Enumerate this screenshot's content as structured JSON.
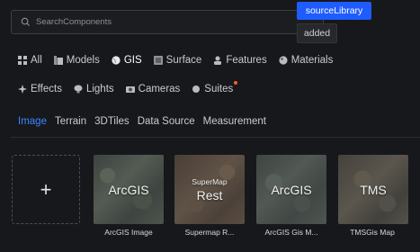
{
  "search": {
    "placeholder": "SearchComponents"
  },
  "tooltips": {
    "primary": "sourceLibrary",
    "secondary": "added"
  },
  "categories_row1": [
    {
      "label": "All",
      "icon": "grid-icon"
    },
    {
      "label": "Models",
      "icon": "cube-icon"
    },
    {
      "label": "GIS",
      "icon": "globe-icon",
      "active": true
    },
    {
      "label": "Surface",
      "icon": "surface-icon"
    },
    {
      "label": "Features",
      "icon": "features-icon"
    },
    {
      "label": "Materials",
      "icon": "material-ball-icon"
    }
  ],
  "categories_row2": [
    {
      "label": "Effects",
      "icon": "sparkle-icon"
    },
    {
      "label": "Lights",
      "icon": "bulb-icon"
    },
    {
      "label": "Cameras",
      "icon": "camera-icon"
    },
    {
      "label": "Suites",
      "icon": "suite-icon",
      "badge": true
    }
  ],
  "subtabs": [
    "Image",
    "Terrain",
    "3DTiles",
    "Data Source",
    "Measurement"
  ],
  "active_subtab": "Image",
  "add_card": {
    "symbol": "+"
  },
  "cards": [
    {
      "thumb_sub": "",
      "thumb_main": "ArcGIS",
      "caption": "ArcGIS Image"
    },
    {
      "thumb_sub": "SuperMap",
      "thumb_main": "Rest",
      "caption": "Supermap R..."
    },
    {
      "thumb_sub": "",
      "thumb_main": "ArcGIS",
      "caption": "ArcGIS Gis M..."
    },
    {
      "thumb_sub": "",
      "thumb_main": "TMS",
      "caption": "TMSGis Map"
    }
  ],
  "colors": {
    "accent": "#3d86ff",
    "tooltip_bg": "#1f5cff",
    "badge": "#ff5a2e",
    "background": "#17181b"
  }
}
